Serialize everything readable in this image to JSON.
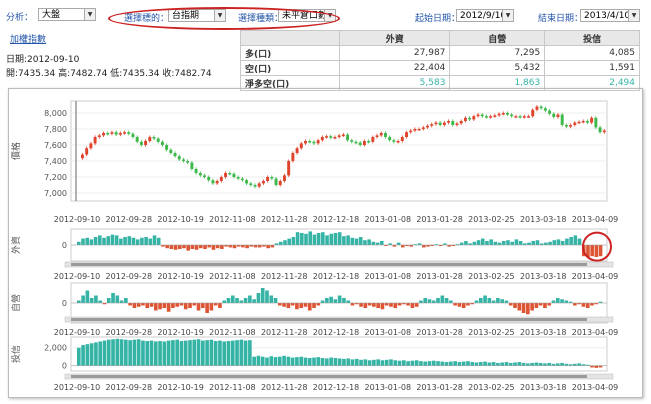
{
  "toolbar": {
    "analysis_label": "分析：",
    "analysis_value": "大盤",
    "select_target_label": "選擇標的：",
    "select_target_value": "台指期",
    "select_kind_label": "選擇種類：",
    "select_kind_value": "未平倉口數",
    "start_label": "起始日期：",
    "start_value": "2012/9/10",
    "end_label": "結束日期：",
    "end_value": "2013/4/10"
  },
  "link_label": "加權指數",
  "info": {
    "date_line": "日期:2012-09-10",
    "ohlc_line": "開:7435.34 高:7482.74 低:7435.34 收:7482.74"
  },
  "summary": {
    "headers": [
      "",
      "外資",
      "自營",
      "投信"
    ],
    "rows": [
      {
        "label": "多(口)",
        "values": [
          "27,987",
          "7,295",
          "4,085"
        ]
      },
      {
        "label": "空(口)",
        "values": [
          "22,404",
          "5,432",
          "1,591"
        ]
      },
      {
        "label": "淨多空(口)",
        "values": [
          "5,583",
          "1,863",
          "2,494"
        ]
      }
    ]
  },
  "chart_data": [
    {
      "type": "candlestick",
      "ylabel": "價格",
      "ylim": [
        6900,
        8150
      ],
      "yticks": [
        "8,000",
        "7,800",
        "7,600",
        "7,400",
        "7,200",
        "7,000"
      ],
      "xticks": [
        "2012-09-10",
        "2012-09-28",
        "2012-10-19",
        "2012-11-08",
        "2012-11-28",
        "2012-12-18",
        "2013-01-08",
        "2013-01-28",
        "2013-02-25",
        "2013-03-18",
        "2013-04-09"
      ],
      "close": [
        7480,
        7560,
        7620,
        7700,
        7720,
        7750,
        7740,
        7760,
        7730,
        7750,
        7760,
        7740,
        7700,
        7640,
        7600,
        7650,
        7700,
        7680,
        7640,
        7600,
        7540,
        7500,
        7460,
        7420,
        7400,
        7380,
        7300,
        7250,
        7220,
        7200,
        7160,
        7120,
        7150,
        7200,
        7250,
        7240,
        7200,
        7180,
        7160,
        7120,
        7100,
        7080,
        7120,
        7150,
        7200,
        7180,
        7100,
        7150,
        7220,
        7400,
        7500,
        7560,
        7620,
        7650,
        7640,
        7620,
        7660,
        7700,
        7710,
        7690,
        7700,
        7720,
        7730,
        7660,
        7640,
        7630,
        7600,
        7650,
        7640,
        7700,
        7720,
        7750,
        7700,
        7660,
        7640,
        7650,
        7700,
        7760,
        7780,
        7800,
        7800,
        7820,
        7840,
        7860,
        7880,
        7850,
        7880,
        7900,
        7850,
        7870,
        7900,
        7940,
        7920,
        7960,
        7980,
        7960,
        7950,
        7960,
        7970,
        7990,
        8000,
        7980,
        7960,
        7960,
        7950,
        7960,
        7960,
        8040,
        8080,
        8060,
        8030,
        7990,
        7950,
        7980,
        7850,
        7830,
        7850,
        7880,
        7890,
        7900,
        7880,
        7940,
        7820,
        7760,
        7780
      ],
      "open": [
        7435,
        7480,
        7560,
        7620,
        7700,
        7720,
        7750,
        7740,
        7760,
        7730,
        7750,
        7760,
        7740,
        7700,
        7640,
        7600,
        7650,
        7700,
        7680,
        7640,
        7600,
        7540,
        7500,
        7460,
        7420,
        7400,
        7380,
        7300,
        7250,
        7220,
        7200,
        7160,
        7120,
        7150,
        7200,
        7250,
        7240,
        7200,
        7180,
        7160,
        7120,
        7100,
        7080,
        7120,
        7150,
        7200,
        7180,
        7100,
        7150,
        7220,
        7400,
        7500,
        7560,
        7620,
        7650,
        7640,
        7620,
        7660,
        7700,
        7710,
        7690,
        7700,
        7720,
        7730,
        7660,
        7640,
        7630,
        7600,
        7650,
        7640,
        7700,
        7720,
        7750,
        7700,
        7660,
        7640,
        7650,
        7700,
        7760,
        7780,
        7800,
        7800,
        7820,
        7840,
        7860,
        7880,
        7850,
        7880,
        7900,
        7850,
        7870,
        7900,
        7940,
        7920,
        7960,
        7980,
        7960,
        7950,
        7960,
        7970,
        7990,
        8000,
        7980,
        7960,
        7960,
        7950,
        7960,
        7960,
        8040,
        8080,
        8060,
        8030,
        7990,
        7950,
        7980,
        7850,
        7830,
        7850,
        7880,
        7890,
        7900,
        7880,
        7940,
        7820,
        7760
      ]
    },
    {
      "type": "bar",
      "ylabel": "外資",
      "ylim": [
        -20000,
        20000
      ],
      "yticks": [
        "0"
      ],
      "values": [
        4000,
        8000,
        9000,
        7000,
        10000,
        12000,
        9000,
        11000,
        13000,
        12000,
        8000,
        10000,
        11000,
        9000,
        7000,
        9000,
        10000,
        8000,
        12000,
        9000,
        -2000,
        -4000,
        -5000,
        -6000,
        -5000,
        -4000,
        -7000,
        -5000,
        -6000,
        -4000,
        -5000,
        -3000,
        -6000,
        -4000,
        -5000,
        -2000,
        -3000,
        -4000,
        -2000,
        -3000,
        -4000,
        -2000,
        -3000,
        -3000,
        -2000,
        -4000,
        -3000,
        2000,
        4000,
        6000,
        8000,
        10000,
        16000,
        15000,
        14000,
        17000,
        13000,
        15000,
        16000,
        12000,
        14000,
        15000,
        16000,
        11000,
        12000,
        9000,
        8000,
        10000,
        6000,
        7000,
        4000,
        3000,
        5000,
        -1000,
        2000,
        -2000,
        3000,
        -3000,
        -1000,
        -2000,
        1000,
        2000,
        -3000,
        -2000,
        -1000,
        1000,
        -1000,
        2000,
        -2000,
        -1000,
        1000,
        3000,
        5000,
        2000,
        4000,
        6000,
        8000,
        5000,
        7000,
        4000,
        3000,
        5000,
        6000,
        4000,
        7000,
        5000,
        2000,
        3000,
        5000,
        6000,
        2000,
        3000,
        4000,
        6000,
        7000,
        5000,
        8000,
        10000,
        12000,
        8000,
        -14000,
        -15000,
        -14000,
        -15000,
        -14000
      ]
    },
    {
      "type": "bar",
      "ylabel": "自營",
      "ylim": [
        -8000,
        8000
      ],
      "yticks": [
        "0"
      ],
      "values": [
        1000,
        3000,
        5000,
        2000,
        3000,
        1000,
        -500,
        2000,
        4000,
        3000,
        1000,
        2000,
        -1000,
        -2000,
        -1500,
        -1000,
        -2000,
        -1500,
        -3000,
        -2500,
        -2000,
        -3500,
        -2000,
        -1500,
        -1000,
        -2500,
        -2000,
        -1000,
        -3000,
        -2000,
        -4000,
        -3000,
        -1000,
        -2000,
        1000,
        2000,
        3000,
        2000,
        1000,
        2000,
        3000,
        1500,
        4000,
        6000,
        5000,
        3000,
        2000,
        -1000,
        -1500,
        -2000,
        -1000,
        -2500,
        -2000,
        -1500,
        -3000,
        -2000,
        -1000,
        1000,
        2000,
        2500,
        1500,
        3000,
        2000,
        1000,
        -1000,
        -500,
        -1500,
        -2000,
        -1000,
        -1500,
        -2000,
        -2500,
        -1000,
        -1500,
        -2000,
        -1000,
        -500,
        -1000,
        -2000,
        -1500,
        1000,
        2000,
        1500,
        1000,
        2000,
        3000,
        2000,
        1000,
        -1000,
        -1500,
        -2000,
        -1000,
        -500,
        1000,
        2000,
        3000,
        2000,
        1000,
        2000,
        1500,
        1000,
        -1000,
        -2000,
        -3000,
        -4000,
        -4500,
        -3000,
        -2000,
        -1000,
        -2000,
        -1000,
        1000,
        2000,
        1500,
        1000,
        500,
        -1000,
        -500,
        -1500,
        -2000,
        -1000,
        -500,
        500
      ]
    },
    {
      "type": "bar",
      "ylabel": "投信",
      "ylim": [
        -600,
        3200
      ],
      "yticks": [
        "2,000",
        "0"
      ],
      "values": [
        2000,
        2300,
        2400,
        2500,
        2600,
        2700,
        2800,
        2900,
        2950,
        3000,
        2950,
        2900,
        2850,
        2900,
        2950,
        2800,
        2750,
        2800,
        2700,
        2750,
        2700,
        2800,
        2850,
        2900,
        2750,
        2800,
        2850,
        2900,
        2950,
        2800,
        2850,
        2900,
        2750,
        2800,
        2700,
        2750,
        2800,
        2850,
        2900,
        2800,
        2850,
        1000,
        1100,
        1000,
        900,
        1050,
        950,
        1000,
        1100,
        1000,
        900,
        950,
        1000,
        900,
        850,
        900,
        950,
        850,
        800,
        900,
        850,
        800,
        750,
        800,
        700,
        750,
        650,
        700,
        600,
        650,
        700,
        600,
        650,
        700,
        600,
        550,
        600,
        500,
        550,
        600,
        500,
        450,
        500,
        550,
        500,
        450,
        400,
        450,
        500,
        400,
        450,
        500,
        400,
        350,
        400,
        450,
        350,
        400,
        300,
        350,
        400,
        300,
        350,
        400,
        300,
        250,
        300,
        350,
        300,
        250,
        300,
        200,
        250,
        300,
        200,
        150,
        200,
        250,
        150,
        100,
        -200,
        -250,
        -200
      ]
    }
  ],
  "colors": {
    "up": "#e0432b",
    "down": "#3cb94a",
    "bar_pos": "#35b4a6",
    "bar_neg": "#dd5533",
    "highlight": "#cc2222"
  }
}
